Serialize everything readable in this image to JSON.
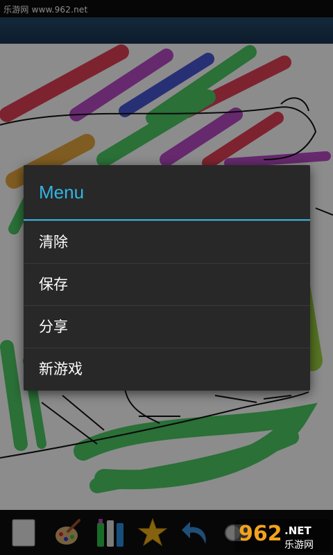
{
  "statusbar": {
    "watermark_text": "乐游网 www.962.net"
  },
  "dialog": {
    "title": "Menu",
    "items": [
      {
        "label": "清除"
      },
      {
        "label": "保存"
      },
      {
        "label": "分享"
      },
      {
        "label": "新游戏"
      }
    ]
  },
  "toolbar": {
    "tools": [
      {
        "icon": "blank-page-icon"
      },
      {
        "icon": "paintbrush-palette-icon"
      },
      {
        "icon": "paint-tubes-icon"
      },
      {
        "icon": "star-stamp-icon"
      },
      {
        "icon": "undo-arrow-icon"
      },
      {
        "icon": "toggle-icon"
      }
    ]
  },
  "logo": {
    "number": "962",
    "suffix": ".NET",
    "subtitle": "乐游网"
  },
  "colors": {
    "accent": "#33b5e5",
    "dialog_bg": "#282828",
    "toolbar_bg": "#0e0e0e",
    "titlebar_bg": "#1a3551"
  }
}
